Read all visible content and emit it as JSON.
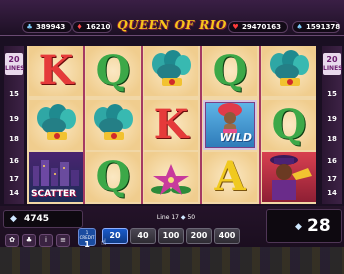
{
  "game": {
    "title": "QUEEN OF RIO"
  },
  "jackpots": [
    {
      "icon": "club-icon",
      "glyph": "♣",
      "color": "#7fd0ff",
      "value": "389943"
    },
    {
      "icon": "diamond-icon",
      "glyph": "♦",
      "color": "#ff4a4a",
      "value": "16210"
    },
    {
      "icon": "heart-icon",
      "glyph": "♥",
      "color": "#ff3b3b",
      "value": "29470163"
    },
    {
      "icon": "spade-icon",
      "glyph": "♠",
      "color": "#7fd0ff",
      "value": "1591378"
    }
  ],
  "lines_panel": {
    "left": {
      "label": "LINES",
      "count": "20",
      "markers": [
        "15",
        "19",
        "18",
        "16",
        "17",
        "14"
      ]
    },
    "right": {
      "label": "LINES",
      "count": "20",
      "markers": [
        "15",
        "19",
        "18",
        "16",
        "17",
        "14"
      ]
    }
  },
  "reels": [
    [
      "K",
      "plume",
      "scatter"
    ],
    [
      "Q",
      "plume",
      "Q"
    ],
    [
      "plume",
      "K",
      "flower"
    ],
    [
      "Q",
      "wild",
      "A"
    ],
    [
      "plume",
      "Q",
      "trumpet"
    ]
  ],
  "symbol_labels": {
    "wild": "WILD",
    "scatter": "SCATTER"
  },
  "status": {
    "credit": "4745",
    "line_info": "Line 17",
    "line_info_win": "50",
    "bet": "28"
  },
  "denomination": {
    "label": "1 CREDIT",
    "value": "1"
  },
  "bet_buttons": [
    {
      "label": "20",
      "selected": true
    },
    {
      "label": "40",
      "selected": false
    },
    {
      "label": "100",
      "selected": false
    },
    {
      "label": "200",
      "selected": false
    },
    {
      "label": "400",
      "selected": false
    }
  ],
  "colors": {
    "accent": "#f6c51b",
    "reel_bg": "#f1d7a6",
    "panel_bg": "#241329"
  }
}
